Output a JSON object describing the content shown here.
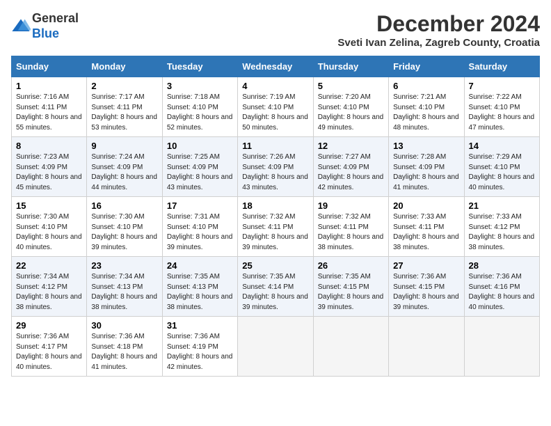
{
  "header": {
    "logo_line1": "General",
    "logo_line2": "Blue",
    "month": "December 2024",
    "location": "Sveti Ivan Zelina, Zagreb County, Croatia"
  },
  "weekdays": [
    "Sunday",
    "Monday",
    "Tuesday",
    "Wednesday",
    "Thursday",
    "Friday",
    "Saturday"
  ],
  "weeks": [
    [
      {
        "day": "1",
        "sunrise": "7:16 AM",
        "sunset": "4:11 PM",
        "daylight": "8 hours and 55 minutes."
      },
      {
        "day": "2",
        "sunrise": "7:17 AM",
        "sunset": "4:11 PM",
        "daylight": "8 hours and 53 minutes."
      },
      {
        "day": "3",
        "sunrise": "7:18 AM",
        "sunset": "4:10 PM",
        "daylight": "8 hours and 52 minutes."
      },
      {
        "day": "4",
        "sunrise": "7:19 AM",
        "sunset": "4:10 PM",
        "daylight": "8 hours and 50 minutes."
      },
      {
        "day": "5",
        "sunrise": "7:20 AM",
        "sunset": "4:10 PM",
        "daylight": "8 hours and 49 minutes."
      },
      {
        "day": "6",
        "sunrise": "7:21 AM",
        "sunset": "4:10 PM",
        "daylight": "8 hours and 48 minutes."
      },
      {
        "day": "7",
        "sunrise": "7:22 AM",
        "sunset": "4:10 PM",
        "daylight": "8 hours and 47 minutes."
      }
    ],
    [
      {
        "day": "8",
        "sunrise": "7:23 AM",
        "sunset": "4:09 PM",
        "daylight": "8 hours and 45 minutes."
      },
      {
        "day": "9",
        "sunrise": "7:24 AM",
        "sunset": "4:09 PM",
        "daylight": "8 hours and 44 minutes."
      },
      {
        "day": "10",
        "sunrise": "7:25 AM",
        "sunset": "4:09 PM",
        "daylight": "8 hours and 43 minutes."
      },
      {
        "day": "11",
        "sunrise": "7:26 AM",
        "sunset": "4:09 PM",
        "daylight": "8 hours and 43 minutes."
      },
      {
        "day": "12",
        "sunrise": "7:27 AM",
        "sunset": "4:09 PM",
        "daylight": "8 hours and 42 minutes."
      },
      {
        "day": "13",
        "sunrise": "7:28 AM",
        "sunset": "4:09 PM",
        "daylight": "8 hours and 41 minutes."
      },
      {
        "day": "14",
        "sunrise": "7:29 AM",
        "sunset": "4:10 PM",
        "daylight": "8 hours and 40 minutes."
      }
    ],
    [
      {
        "day": "15",
        "sunrise": "7:30 AM",
        "sunset": "4:10 PM",
        "daylight": "8 hours and 40 minutes."
      },
      {
        "day": "16",
        "sunrise": "7:30 AM",
        "sunset": "4:10 PM",
        "daylight": "8 hours and 39 minutes."
      },
      {
        "day": "17",
        "sunrise": "7:31 AM",
        "sunset": "4:10 PM",
        "daylight": "8 hours and 39 minutes."
      },
      {
        "day": "18",
        "sunrise": "7:32 AM",
        "sunset": "4:11 PM",
        "daylight": "8 hours and 39 minutes."
      },
      {
        "day": "19",
        "sunrise": "7:32 AM",
        "sunset": "4:11 PM",
        "daylight": "8 hours and 38 minutes."
      },
      {
        "day": "20",
        "sunrise": "7:33 AM",
        "sunset": "4:11 PM",
        "daylight": "8 hours and 38 minutes."
      },
      {
        "day": "21",
        "sunrise": "7:33 AM",
        "sunset": "4:12 PM",
        "daylight": "8 hours and 38 minutes."
      }
    ],
    [
      {
        "day": "22",
        "sunrise": "7:34 AM",
        "sunset": "4:12 PM",
        "daylight": "8 hours and 38 minutes."
      },
      {
        "day": "23",
        "sunrise": "7:34 AM",
        "sunset": "4:13 PM",
        "daylight": "8 hours and 38 minutes."
      },
      {
        "day": "24",
        "sunrise": "7:35 AM",
        "sunset": "4:13 PM",
        "daylight": "8 hours and 38 minutes."
      },
      {
        "day": "25",
        "sunrise": "7:35 AM",
        "sunset": "4:14 PM",
        "daylight": "8 hours and 39 minutes."
      },
      {
        "day": "26",
        "sunrise": "7:35 AM",
        "sunset": "4:15 PM",
        "daylight": "8 hours and 39 minutes."
      },
      {
        "day": "27",
        "sunrise": "7:36 AM",
        "sunset": "4:15 PM",
        "daylight": "8 hours and 39 minutes."
      },
      {
        "day": "28",
        "sunrise": "7:36 AM",
        "sunset": "4:16 PM",
        "daylight": "8 hours and 40 minutes."
      }
    ],
    [
      {
        "day": "29",
        "sunrise": "7:36 AM",
        "sunset": "4:17 PM",
        "daylight": "8 hours and 40 minutes."
      },
      {
        "day": "30",
        "sunrise": "7:36 AM",
        "sunset": "4:18 PM",
        "daylight": "8 hours and 41 minutes."
      },
      {
        "day": "31",
        "sunrise": "7:36 AM",
        "sunset": "4:19 PM",
        "daylight": "8 hours and 42 minutes."
      },
      null,
      null,
      null,
      null
    ]
  ],
  "labels": {
    "sunrise": "Sunrise:",
    "sunset": "Sunset:",
    "daylight": "Daylight:"
  }
}
